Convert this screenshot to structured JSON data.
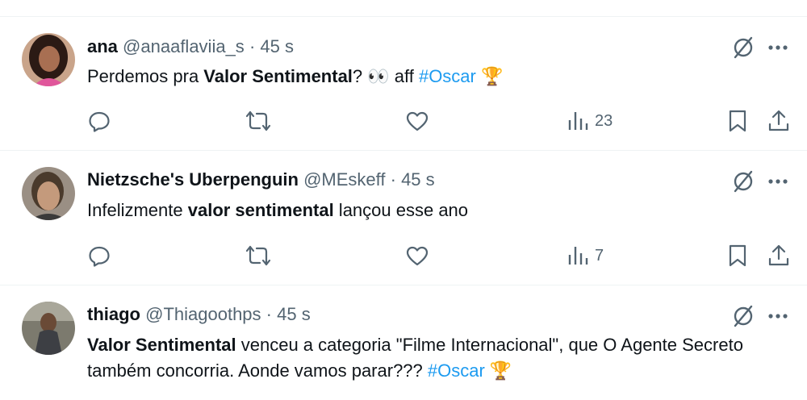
{
  "tweets": [
    {
      "name": "ana",
      "handle": "@anaaflaviia_s",
      "separator": "·",
      "time": "45 s",
      "text_parts": {
        "a": "Perdemos pra ",
        "b": "Valor Sentimental",
        "c": "? 👀 aff ",
        "tag": "#Oscar",
        "emoji": " 🏆"
      },
      "views": "23"
    },
    {
      "name": "Nietzsche's Uberpenguin",
      "handle": "@MEskeff",
      "separator": "·",
      "time": "45 s",
      "text_parts": {
        "a": "Infelizmente ",
        "b": "valor sentimental",
        "c": " lançou esse ano"
      },
      "views": "7"
    },
    {
      "name": "thiago",
      "handle": "@Thiagoothps",
      "separator": "·",
      "time": "45 s",
      "text_parts": {
        "b": "Valor Sentimental",
        "c": " venceu a categoria \"Filme Internacional\", que O Agente Secreto também concorria. Aonde vamos parar??? ",
        "tag": "#Oscar",
        "emoji": " 🏆"
      }
    }
  ],
  "icons": {
    "reply": "reply-icon",
    "retweet": "retweet-icon",
    "like": "like-icon",
    "views": "views-icon",
    "bookmark": "bookmark-icon",
    "share": "share-icon",
    "grok": "grok-icon",
    "more": "more-icon"
  },
  "colors": {
    "text": "#0f1419",
    "secondary": "#536471",
    "link": "#1d9bf0",
    "divider": "#eff3f4"
  }
}
